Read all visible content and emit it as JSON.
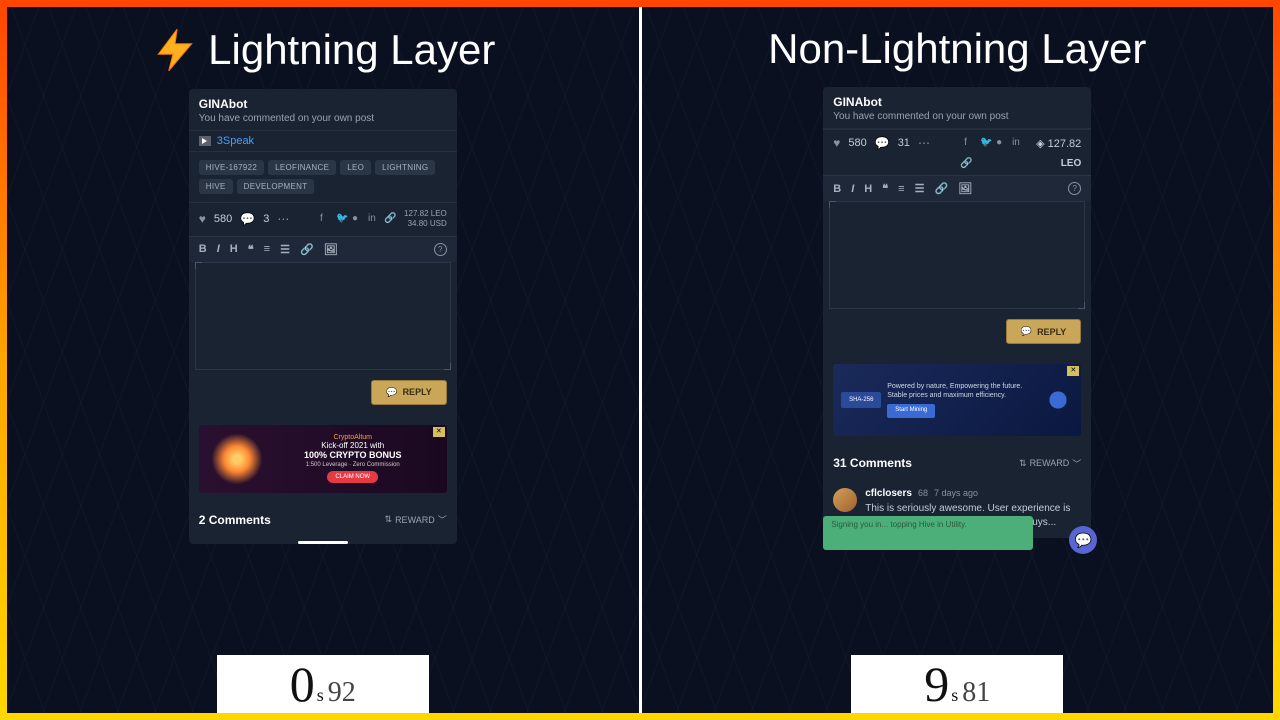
{
  "left": {
    "title": "Lightning Layer",
    "notif": {
      "user": "GINAbot",
      "msg": "You have commented on your own post"
    },
    "speak_link": "3Speak",
    "tags": [
      "HIVE-167922",
      "LEOFINANCE",
      "LEO",
      "LIGHTNING",
      "HIVE",
      "DEVELOPMENT"
    ],
    "likes": "580",
    "comments_n": "3",
    "amount_leo": "127.82 LEO",
    "amount_usd": "34.80 USD",
    "reply": "REPLY",
    "ad": {
      "brand": "CryptoAltum",
      "l2": "Kick-off 2021 with",
      "l3": "100% CRYPTO BONUS",
      "l4": "1:500 Leverage · Zero Commission",
      "cta": "CLAIM NOW"
    },
    "comments_title": "2 Comments",
    "sort": "REWARD",
    "timer": {
      "sec": "0",
      "ms": "92"
    }
  },
  "right": {
    "title": "Non-Lightning Layer",
    "notif": {
      "user": "GINAbot",
      "msg": "You have commented on your own post"
    },
    "likes": "580",
    "comments_n": "31",
    "amount_leo": "127.82",
    "amount_unit": "LEO",
    "reply": "REPLY",
    "ad": {
      "brand": "SHA-256",
      "txt": "Powered by nature, Empowering the future. Stable prices and maximum efficiency.",
      "cta": "Start Mining"
    },
    "comments_title": "31 Comments",
    "sort": "REWARD",
    "comment": {
      "user": "cflclosers",
      "rep": "68",
      "ago": "7 days ago",
      "txt": "This is seriously awesome. User experience is so important. It's crazy how fast you guys..."
    },
    "toast": "Signing you in... topping Hive in Utility.",
    "timer": {
      "sec": "9",
      "ms": "81"
    }
  }
}
